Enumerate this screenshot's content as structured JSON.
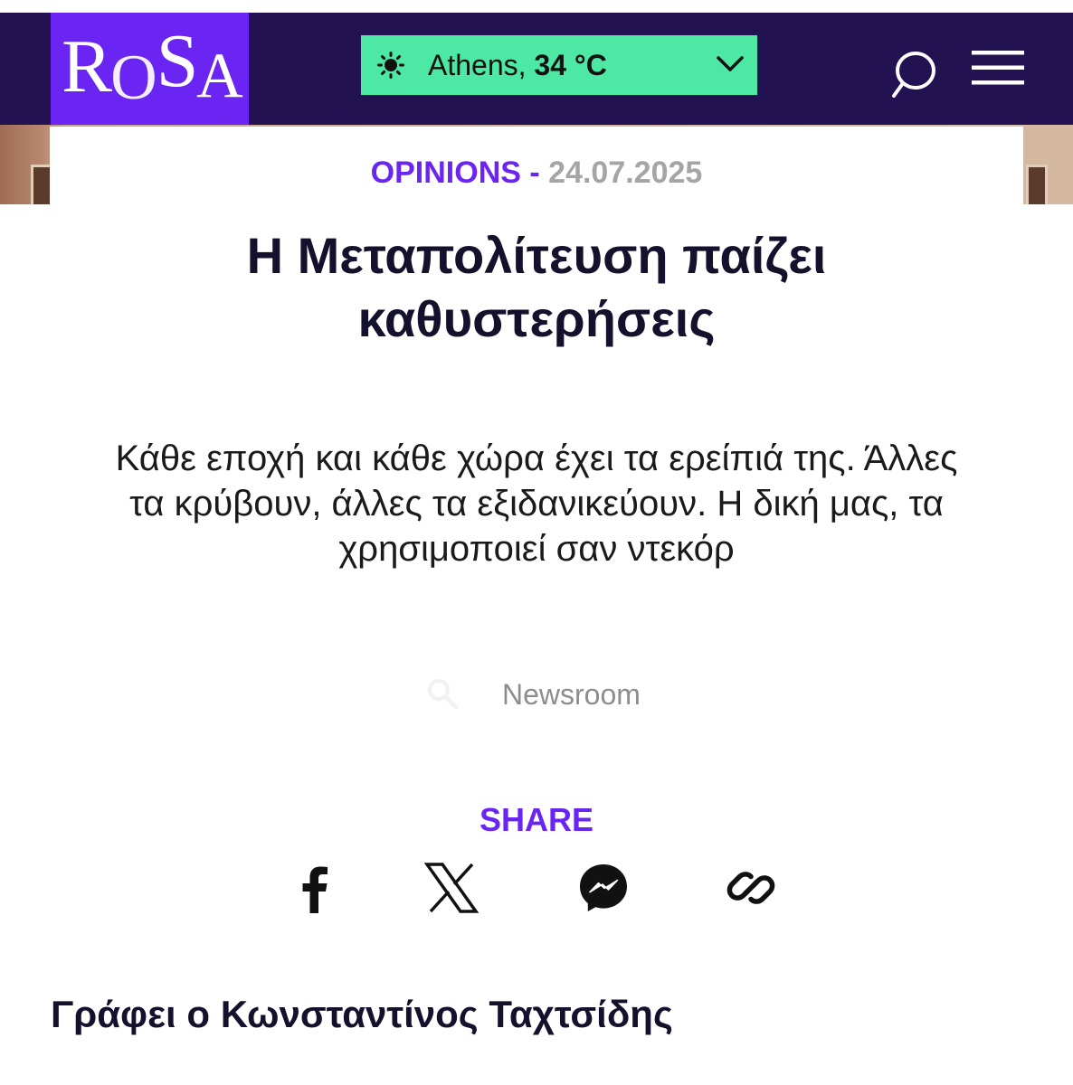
{
  "header": {
    "logo": "RoSA",
    "weather": {
      "city": "Athens,",
      "temperature": "34 °C",
      "icon": "sun-icon"
    },
    "search_icon": "search-icon",
    "menu_icon": "hamburger-menu-icon",
    "colors": {
      "bar": "#231251",
      "logo_bg": "#6a25f2",
      "weather_bg": "#4ce8a4"
    }
  },
  "article": {
    "category": "OPINIONS",
    "separator": "-",
    "date": "24.07.2025",
    "title_line1": "Η Μεταπολίτευση παίζει",
    "title_line2": "καθυστερήσεις",
    "lead": "Κάθε εποχή και κάθε χώρα έχει τα ερείπιά της. Άλλες τα κρύβουν, άλλες τα εξιδανικεύουν. Η δική μας, τα χρησιμοποιεί σαν ντεκόρ",
    "author": "Newsroom",
    "byline": "Γράφει ο Κωνσταντίνος Ταχτσίδης"
  },
  "share": {
    "label": "SHARE",
    "icons": [
      "facebook-icon",
      "x-twitter-icon",
      "messenger-icon",
      "link-icon"
    ]
  },
  "accent_color": "#6a25f2"
}
